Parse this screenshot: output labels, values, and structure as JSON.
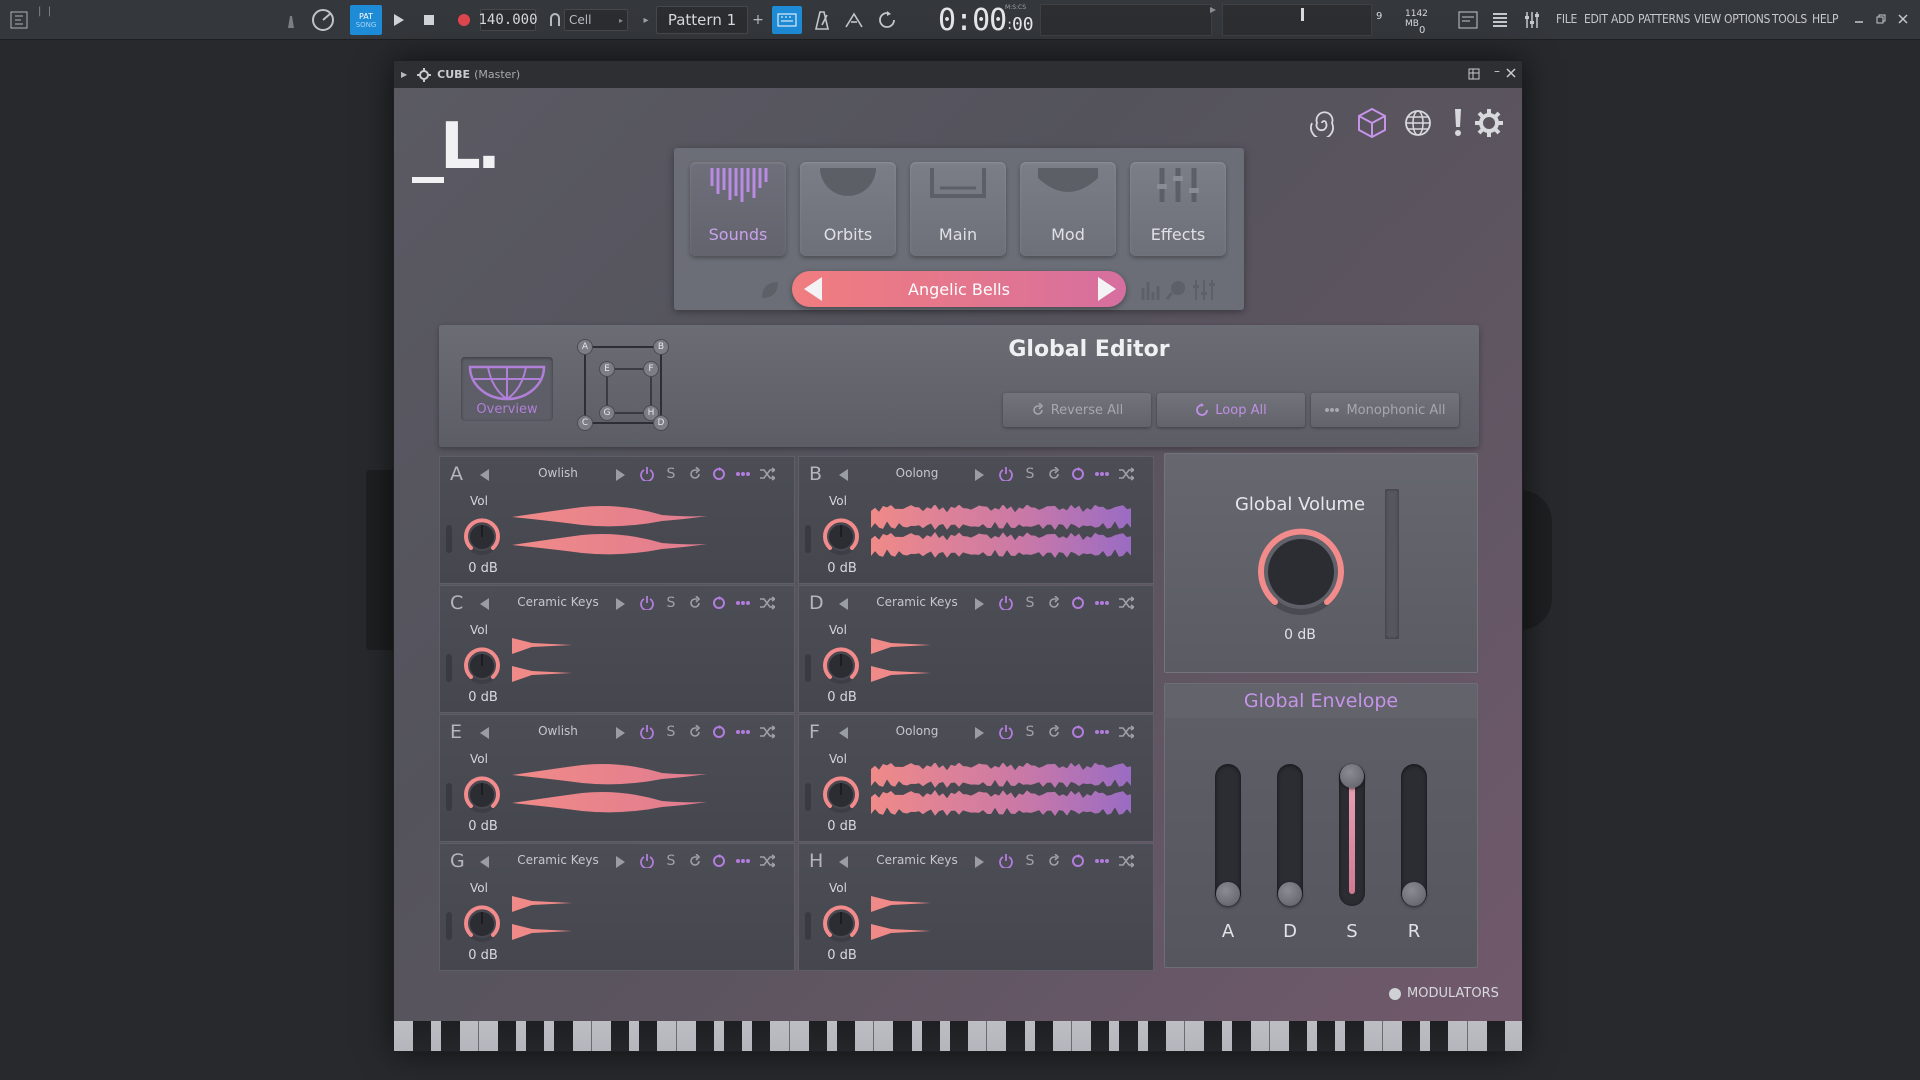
{
  "toolbar": {
    "pat_label": "PAT",
    "song_label": "SONG",
    "bpm": "140.000",
    "snap": "Cell",
    "pattern": "Pattern 1",
    "time_main": "0:00",
    "time_small": "00",
    "time_unit": "M:S:CS",
    "cpu_value": "9",
    "mem_value": "1142 MB",
    "poly_value": "0",
    "menu": [
      "FILE",
      "EDIT",
      "ADD",
      "PATTERNS",
      "VIEW",
      "OPTIONS",
      "TOOLS",
      "HELP"
    ]
  },
  "plugin": {
    "title": "CUBE",
    "title_suffix": "(Master)",
    "tabs": [
      {
        "label": "Sounds",
        "active": true
      },
      {
        "label": "Orbits",
        "active": false
      },
      {
        "label": "Main",
        "active": false
      },
      {
        "label": "Mod",
        "active": false
      },
      {
        "label": "Effects",
        "active": false
      }
    ],
    "preset": "Angelic Bells",
    "global_editor": {
      "title": "Global Editor",
      "overview_label": "Overview",
      "cube_nodes": [
        "A",
        "B",
        "E",
        "F",
        "G",
        "H",
        "C",
        "D"
      ],
      "buttons": {
        "reverse_all": "Reverse All",
        "loop_all": "Loop All",
        "monophonic_all": "Monophonic All"
      }
    },
    "slots": [
      {
        "letter": "A",
        "sample": "Owlish",
        "vol_label": "Vol",
        "db": "0 dB"
      },
      {
        "letter": "B",
        "sample": "Oolong",
        "vol_label": "Vol",
        "db": "0 dB"
      },
      {
        "letter": "C",
        "sample": "Ceramic Keys",
        "vol_label": "Vol",
        "db": "0 dB"
      },
      {
        "letter": "D",
        "sample": "Ceramic Keys",
        "vol_label": "Vol",
        "db": "0 dB"
      },
      {
        "letter": "E",
        "sample": "Owlish",
        "vol_label": "Vol",
        "db": "0 dB"
      },
      {
        "letter": "F",
        "sample": "Oolong",
        "vol_label": "Vol",
        "db": "0 dB"
      },
      {
        "letter": "G",
        "sample": "Ceramic Keys",
        "vol_label": "Vol",
        "db": "0 dB"
      },
      {
        "letter": "H",
        "sample": "Ceramic Keys",
        "vol_label": "Vol",
        "db": "0 dB"
      }
    ],
    "global_volume": {
      "title": "Global Volume",
      "db": "0 dB"
    },
    "global_envelope": {
      "title": "Global Envelope",
      "labels": [
        "A",
        "D",
        "S",
        "R"
      ],
      "levels": [
        0,
        0,
        1,
        0
      ]
    },
    "modulators_label": "MODULATORS",
    "colors": {
      "accent": "#c594e8",
      "preset_start": "#f07d7f",
      "preset_end": "#d66fa0",
      "knob_ring": "#f28b8b"
    }
  }
}
